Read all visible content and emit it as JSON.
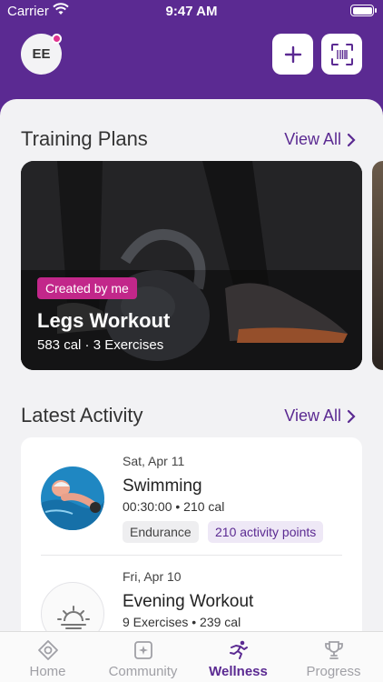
{
  "status_bar": {
    "carrier": "Carrier",
    "time": "9:47 AM"
  },
  "header": {
    "avatar_initials": "EE"
  },
  "training_plans": {
    "title": "Training Plans",
    "view_all": "View All",
    "card": {
      "badge": "Created by me",
      "name": "Legs Workout",
      "meta": "583 cal · 3 Exercises"
    }
  },
  "latest_activity": {
    "title": "Latest Activity",
    "view_all": "View All",
    "items": [
      {
        "date": "Sat, Apr 11",
        "name": "Swimming",
        "meta": "00:30:00 • 210 cal",
        "tag1": "Endurance",
        "tag2": "210 activity points"
      },
      {
        "date": "Fri, Apr 10",
        "name": "Evening Workout",
        "meta": "9 Exercises • 239 cal"
      }
    ]
  },
  "tabs": [
    {
      "label": "Home",
      "icon": "home-icon"
    },
    {
      "label": "Community",
      "icon": "community-icon"
    },
    {
      "label": "Wellness",
      "icon": "wellness-icon"
    },
    {
      "label": "Progress",
      "icon": "trophy-icon"
    }
  ],
  "colors": {
    "brand": "#5b2a92",
    "badge": "#c2278a",
    "notification": "#e0338f"
  }
}
